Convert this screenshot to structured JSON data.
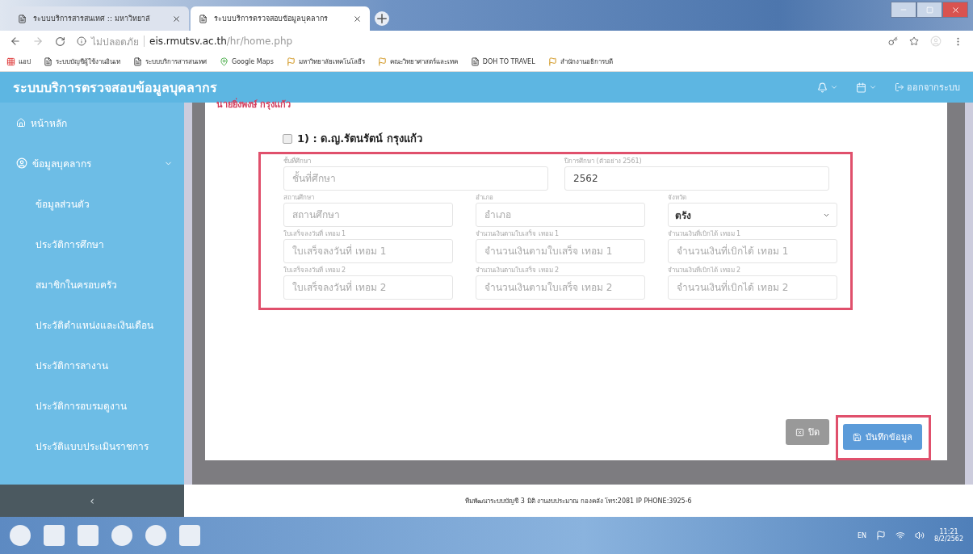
{
  "browser": {
    "tabs": [
      {
        "title": "ระบบบริการสารสนเทศ :: มหาวิทยาลั",
        "selected": false
      },
      {
        "title": "ระบบบริการตรวจสอบข้อมูลบุคลากร",
        "selected": true
      }
    ],
    "address": {
      "security": "ไม่ปลอดภัย",
      "host": "eis.rmutsv.ac.th",
      "path": "/hr/home.php"
    },
    "bookmarks": [
      {
        "label": "แอป",
        "kind": "apps"
      },
      {
        "label": "ระบบบัญชีผู้ใช้งานอินเท",
        "kind": "page"
      },
      {
        "label": "ระบบบริการสารสนเทศ",
        "kind": "page"
      },
      {
        "label": "Google Maps",
        "kind": "maps"
      },
      {
        "label": "มหาวิทยาลัยเทคโนโลยีร",
        "kind": "logo"
      },
      {
        "label": "คณะวิทยาศาสตร์และเทค",
        "kind": "logo"
      },
      {
        "label": "DOH TO TRAVEL",
        "kind": "page"
      },
      {
        "label": "สำนักงานอธิการบดี",
        "kind": "logo"
      }
    ]
  },
  "app": {
    "title": "ระบบบริการตรวจสอบข้อมูลบุคลากร",
    "logout": "ออกจากระบบ"
  },
  "sidebar": {
    "items": [
      {
        "label": "หน้าหลัก",
        "kind": "home"
      },
      {
        "label": "ข้อมูลบุคลากร",
        "kind": "user",
        "expanded": true,
        "children": [
          {
            "label": "ข้อมูลส่วนตัว"
          },
          {
            "label": "ประวัติการศึกษา"
          },
          {
            "label": "สมาชิกในครอบครัว"
          },
          {
            "label": "ประวัติตำแหน่งและเงินเดือน"
          },
          {
            "label": "ประวัติการลางาน"
          },
          {
            "label": "ประวัติการอบรมดูงาน"
          },
          {
            "label": "ประวัติแบบประเมินราชการ"
          }
        ]
      }
    ],
    "collapse": "‹"
  },
  "modal": {
    "heading": "นายยิ่งพงษ์ กรุงแก้ว",
    "entry": {
      "checked": false,
      "label": "1) : ด.ญ.รัตนรัตน์ กรุงแก้ว"
    },
    "rows": [
      [
        {
          "kind": "input",
          "label": "ชั้นที่ศึกษา",
          "placeholder": "ชั้นที่ศึกษา"
        },
        {
          "kind": "input",
          "label": "ปีการศึกษา (ตัวอย่าง 2561)",
          "value": "2562"
        }
      ],
      [
        {
          "kind": "input",
          "label": "สถานศึกษา",
          "placeholder": "สถานศึกษา"
        },
        {
          "kind": "input",
          "label": "อำเภอ",
          "placeholder": "อำเภอ"
        },
        {
          "kind": "select",
          "label": "จังหวัด",
          "value": "ตรัง"
        }
      ],
      [
        {
          "kind": "input",
          "label": "ใบเสร็จลงวันที่ เทอม 1",
          "placeholder": "ใบเสร็จลงวันที่ เทอม 1"
        },
        {
          "kind": "input",
          "label": "จำนวนเงินตามใบเสร็จ เทอม 1",
          "placeholder": "จำนวนเงินตามใบเสร็จ เทอม 1"
        },
        {
          "kind": "input",
          "label": "จำนวนเงินที่เบิกได้ เทอม 1",
          "placeholder": "จำนวนเงินที่เบิกได้ เทอม 1"
        }
      ],
      [
        {
          "kind": "input",
          "label": "ใบเสร็จลงวันที่ เทอม 2",
          "placeholder": "ใบเสร็จลงวันที่ เทอม 2"
        },
        {
          "kind": "input",
          "label": "จำนวนเงินตามใบเสร็จ เทอม 2",
          "placeholder": "จำนวนเงินตามใบเสร็จ เทอม 2"
        },
        {
          "kind": "input",
          "label": "จำนวนเงินที่เบิกได้ เทอม 2",
          "placeholder": "จำนวนเงินที่เบิกได้ เทอม 2"
        }
      ]
    ],
    "buttons": [
      {
        "kind": "close",
        "label": "ปิด"
      },
      {
        "kind": "save",
        "label": "บันทึกข้อมูล"
      }
    ]
  },
  "footer": "ทีมพัฒนาระบบบัญชี 3 มิติ งานงบประมาณ กองคลัง โทร:2081 IP PHONE:3925-6",
  "taskbar": {
    "language": "EN",
    "time": "11:21",
    "date": "8/2/2562"
  }
}
